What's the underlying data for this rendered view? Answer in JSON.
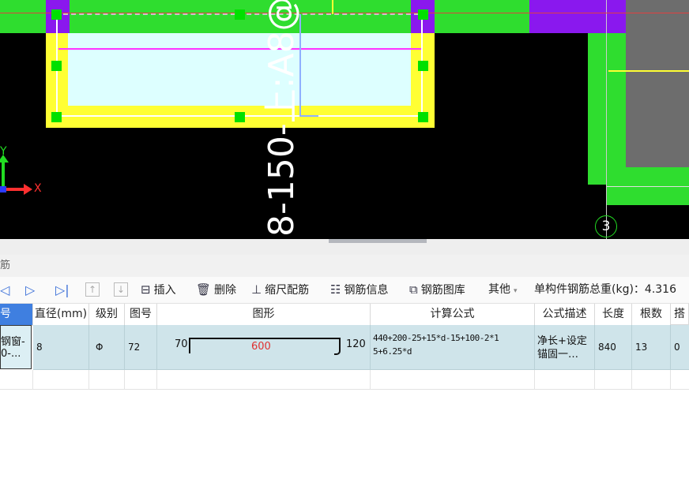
{
  "canvas": {
    "annotation_text": "8-150-上:A8@",
    "axis_y_label": "Y",
    "axis_x_label": "X",
    "grid_marker": "3"
  },
  "panel": {
    "title_partial": "筋"
  },
  "toolbar": {
    "insert_label": "插入",
    "delete_label": "删除",
    "scale_rebar_label": "缩尺配筋",
    "rebar_info_label": "钢筋信息",
    "rebar_library_label": "钢筋图库",
    "other_label": "其他",
    "total_weight_label": "单构件钢筋总重(kg)：4.316"
  },
  "table": {
    "headers": {
      "name": "号",
      "diameter": "直径(mm)",
      "grade": "级别",
      "shape_no": "图号",
      "shape": "图形",
      "formula": "计算公式",
      "description": "公式描述",
      "length": "长度",
      "count": "根数",
      "more": "搭"
    },
    "row": {
      "name_line1": "钢窗-",
      "name_line2": "0-...",
      "diameter": "8",
      "grade": "Φ",
      "shape_no": "72",
      "shape_left": "70",
      "shape_mid": "600",
      "shape_right": "120",
      "formula_line1": "440+200-25+15*d-15+100-2*1",
      "formula_line2": "5+6.25*d",
      "description_line1": "净长+设定",
      "description_line2": "锚固一…",
      "length": "840",
      "count": "13",
      "more": "0"
    }
  },
  "colors": {
    "rebar_mid_text": "#e03030",
    "cad_green": "#2fdd2f",
    "cad_yellow": "#ffff33",
    "cad_purple": "#8a18ee",
    "cad_cyan": "#ddffff",
    "cad_magenta": "#ff33ff",
    "row_selected": "#cfe4ea",
    "toolbar_icon_blue": "#3a6fd8"
  }
}
